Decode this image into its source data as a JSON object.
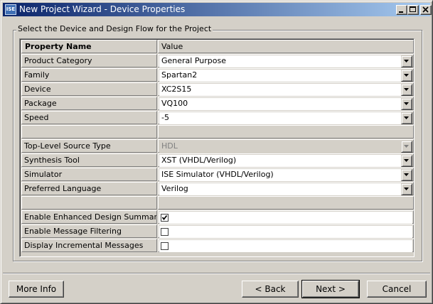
{
  "window": {
    "title": "New Project Wizard - Device Properties",
    "icon": "ise-app-icon"
  },
  "group": {
    "label": "Select the Device and Design Flow for the Project"
  },
  "grid": {
    "header_name": "Property Name",
    "header_value": "Value",
    "rows": [
      {
        "name": "Product Category",
        "value": "General Purpose",
        "type": "combo"
      },
      {
        "name": "Family",
        "value": "Spartan2",
        "type": "combo"
      },
      {
        "name": "Device",
        "value": "XC2S15",
        "type": "combo"
      },
      {
        "name": "Package",
        "value": "VQ100",
        "type": "combo"
      },
      {
        "name": "Speed",
        "value": "-5",
        "type": "combo"
      },
      {
        "name": "",
        "value": "",
        "type": "empty"
      },
      {
        "name": "Top-Level Source Type",
        "value": "HDL",
        "type": "combo-disabled"
      },
      {
        "name": "Synthesis Tool",
        "value": "XST (VHDL/Verilog)",
        "type": "combo"
      },
      {
        "name": "Simulator",
        "value": "ISE Simulator (VHDL/Verilog)",
        "type": "combo"
      },
      {
        "name": "Preferred Language",
        "value": "Verilog",
        "type": "combo"
      },
      {
        "name": "",
        "value": "",
        "type": "empty"
      },
      {
        "name": "Enable Enhanced Design Summary",
        "checked": true,
        "type": "checkbox"
      },
      {
        "name": "Enable Message Filtering",
        "checked": false,
        "type": "checkbox"
      },
      {
        "name": "Display Incremental Messages",
        "checked": false,
        "type": "checkbox"
      }
    ]
  },
  "buttons": {
    "more_info": "More Info",
    "back": "< Back",
    "next": "Next >",
    "cancel": "Cancel"
  }
}
